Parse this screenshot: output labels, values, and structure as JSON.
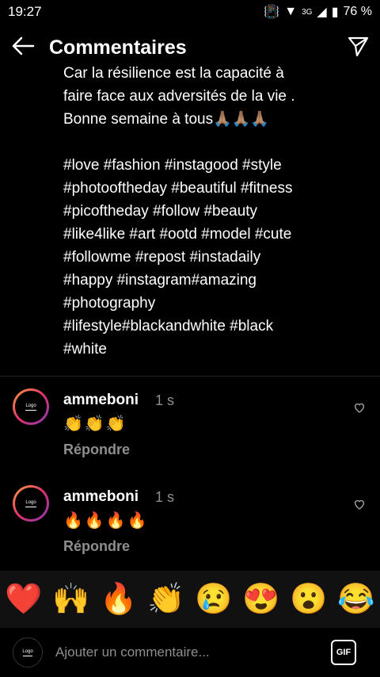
{
  "status": {
    "time": "19:27",
    "battery": "76 %",
    "network": "3G"
  },
  "header": {
    "title": "Commentaires"
  },
  "caption": {
    "text": "Car la résilience est la capacité à\nfaire face aux adversités de la vie .\nBonne semaine à tous🙏🏽🙏🏽🙏🏽\n\n#love #fashion #instagood #style\n#photooftheday #beautiful #fitness\n#picoftheday #follow #beauty\n#like4like #art #ootd #model #cute\n#followme #repost #instadaily\n#happy #instagram#amazing\n#photography\n#lifestyle#blackandwhite #black\n#white"
  },
  "comments": [
    {
      "username": "ammeboni",
      "time": "1 s",
      "text": "👏👏👏",
      "reply": "Répondre"
    },
    {
      "username": "ammeboni",
      "time": "1 s",
      "text": "🔥🔥🔥🔥",
      "reply": "Répondre"
    }
  ],
  "reactions": [
    "❤️",
    "🙌",
    "🔥",
    "👏",
    "😢",
    "😍",
    "😮",
    "😂"
  ],
  "input": {
    "placeholder": "Ajouter un commentaire...",
    "gif_label": "GIF"
  },
  "avatar_text": "Logo"
}
